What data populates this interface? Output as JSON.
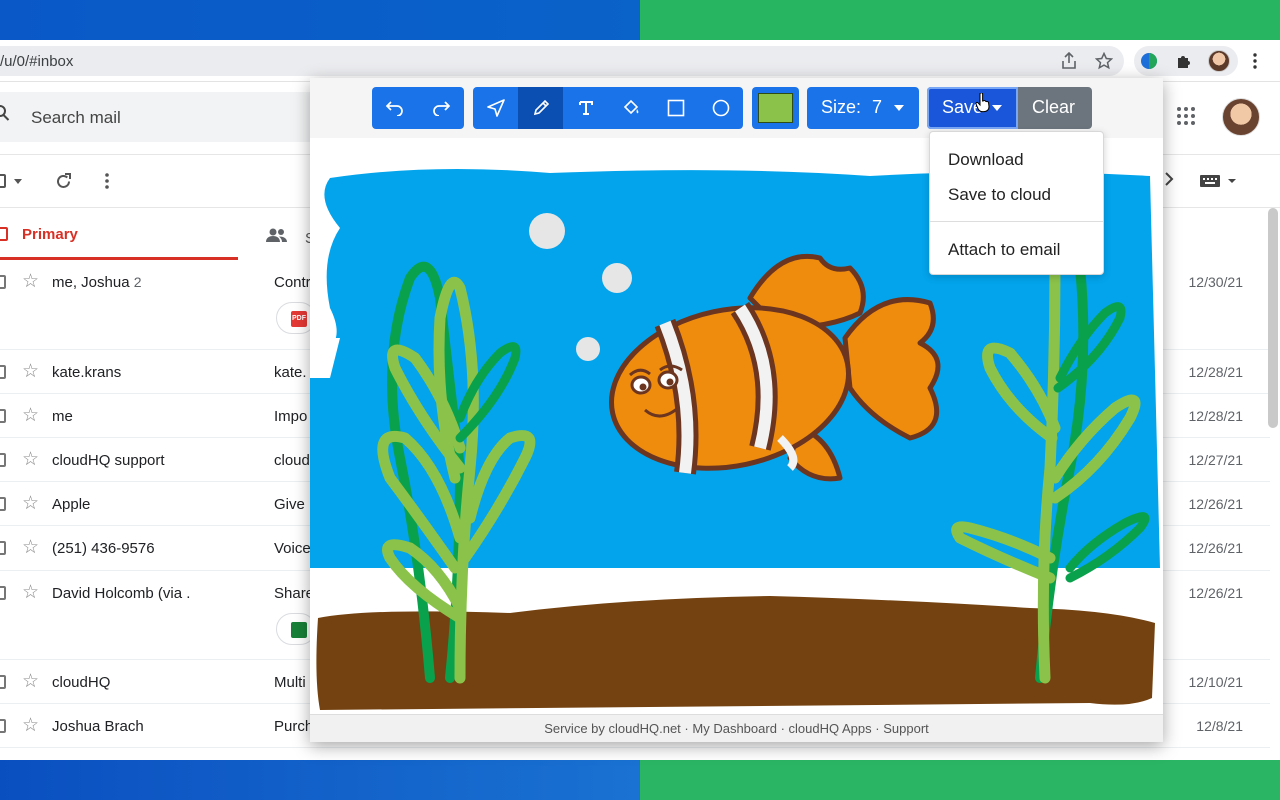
{
  "browser": {
    "url": "/u/0/#inbox",
    "icons": [
      "share-icon",
      "star-icon",
      "extension-icon",
      "puzzle-icon",
      "profile-avatar",
      "more-icon"
    ]
  },
  "gmail": {
    "search_placeholder": "Search mail",
    "tabs": {
      "primary": "Primary",
      "social_initial": "S"
    },
    "emails": [
      {
        "sender": "me, Joshua",
        "count": "2",
        "subject": "Contr",
        "date": "12/30/21",
        "attachment": "pdf"
      },
      {
        "sender": "kate.krans",
        "subject": "kate.",
        "date": "12/28/21"
      },
      {
        "sender": "me",
        "subject": "Impo",
        "date": "12/28/21"
      },
      {
        "sender": "cloudHQ support",
        "subject": "cloud",
        "date": "12/27/21"
      },
      {
        "sender": "Apple",
        "subject": "Give",
        "date": "12/26/21"
      },
      {
        "sender": "(251) 436-9576",
        "subject": "Voice",
        "date": "12/26/21"
      },
      {
        "sender": "David Holcomb (via .",
        "subject": "Share",
        "date": "12/26/21",
        "attachment": "sheet"
      },
      {
        "sender": "cloudHQ",
        "subject": "Multi",
        "date": "12/10/21"
      },
      {
        "sender": "Joshua Brach",
        "subject": "Purch",
        "date": "12/8/21"
      }
    ]
  },
  "drawing": {
    "toolbar": {
      "undo": "undo-icon",
      "redo": "redo-icon",
      "tools": [
        "select-arrow-icon",
        "pencil-icon",
        "text-icon",
        "fill-bucket-icon",
        "rectangle-icon",
        "circle-icon"
      ],
      "active_tool": "pencil-icon",
      "color": "#8bc34a",
      "size_label": "Size:",
      "size_value": "7",
      "save_label": "Save",
      "clear_label": "Clear"
    },
    "save_menu": {
      "items": [
        "Download",
        "Save to cloud",
        "Attach to email"
      ]
    },
    "footer": {
      "prefix": "Service by",
      "brand": "cloudHQ.net",
      "links": [
        "My Dashboard",
        "cloudHQ Apps",
        "Support"
      ],
      "separator": "·"
    }
  },
  "colors": {
    "accent": "#1a73e8",
    "water": "#03a4ec",
    "sand": "#744210",
    "fish": "#ef8c0e",
    "seaweed_light": "#8bc34a",
    "seaweed_dark": "#0aa14c"
  }
}
